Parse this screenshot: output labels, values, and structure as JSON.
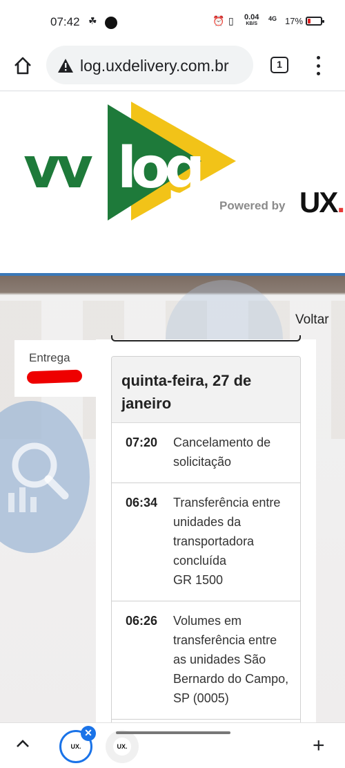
{
  "status_bar": {
    "time": "07:42",
    "net_speed": "0.04",
    "net_unit": "KB/S",
    "network": "4G",
    "battery": "17%"
  },
  "browser": {
    "url": "log.uxdelivery.com.br",
    "tab_count": "1"
  },
  "header": {
    "logo_text": "vvlog",
    "powered_by": "Powered by",
    "ux_logo": "UX",
    "colors": {
      "green": "#1e7a3a",
      "yellow": "#f2c318"
    }
  },
  "page": {
    "back_link": "Voltar",
    "entrega_label": "Entrega"
  },
  "tracking": {
    "day": "quinta-feira, 27 de janeiro",
    "events": [
      {
        "time": "07:20",
        "description": "Cancelamento de solicitação",
        "detail": ""
      },
      {
        "time": "06:34",
        "description": "Transferência entre unidades da transportadora concluída",
        "detail": "GR 1500"
      },
      {
        "time": "06:26",
        "description": "Volumes em transferência entre as unidades São Bernardo do Campo, SP (0005)",
        "detail": ""
      }
    ]
  },
  "tab_strip": {
    "tab1_favicon": "UX.",
    "tab2_favicon": "UX."
  }
}
